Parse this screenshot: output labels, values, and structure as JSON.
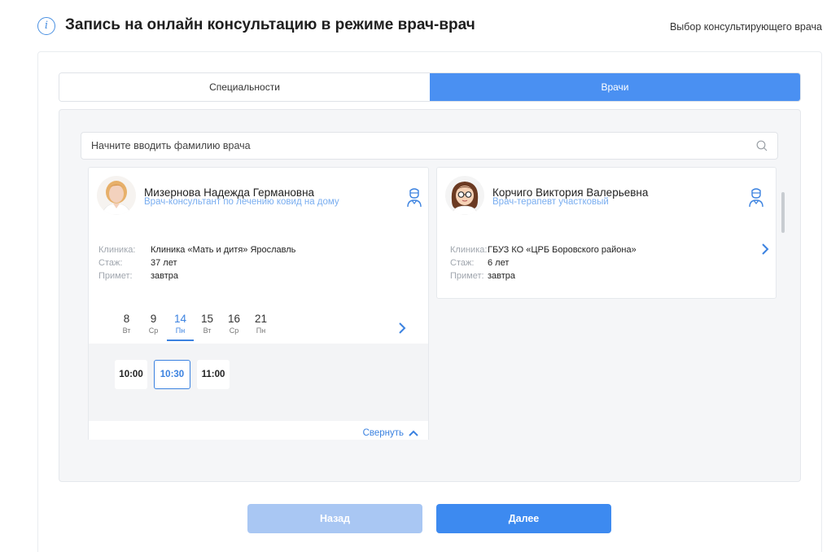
{
  "header": {
    "title": "Запись на онлайн консультацию в режиме врач-врач",
    "subtitle": "Выбор консультирующего врача"
  },
  "tabs": [
    {
      "label": "Специальности",
      "active": false
    },
    {
      "label": "Врачи",
      "active": true
    }
  ],
  "search": {
    "placeholder": "Начните вводить фамилию врача"
  },
  "labels": {
    "clinic": "Клиника:",
    "experience": "Стаж:",
    "accepts": "Примет:"
  },
  "doctors": [
    {
      "name": "Мизернова Надежда Германовна",
      "specialty": "Врач-консультант по лечению ковид на дому",
      "clinic": "Клиника «Мать и дитя» Ярославль",
      "experience": "37 лет",
      "accepts": "завтра",
      "expanded": true
    },
    {
      "name": "Корчиго Виктория Валерьевна",
      "specialty": "Врач-терапевт участковый",
      "clinic": "ГБУЗ КО «ЦРБ Боровского района»",
      "experience": "6 лет",
      "accepts": "завтра",
      "expanded": false
    }
  ],
  "schedule": {
    "days": [
      {
        "num": "8",
        "weekday": "Вт"
      },
      {
        "num": "9",
        "weekday": "Ср"
      },
      {
        "num": "14",
        "weekday": "Пн"
      },
      {
        "num": "15",
        "weekday": "Вт"
      },
      {
        "num": "16",
        "weekday": "Ср"
      },
      {
        "num": "21",
        "weekday": "Пн"
      }
    ],
    "active_day": "14",
    "slots": [
      "10:00",
      "10:30",
      "11:00"
    ],
    "selected_slot": "10:30"
  },
  "collapse_label": "Свернуть",
  "buttons": {
    "back": "Назад",
    "next": "Далее"
  },
  "colors": {
    "accent": "#4a90f2",
    "accent_disabled": "#a9c7f3",
    "link": "#3b82e0"
  }
}
